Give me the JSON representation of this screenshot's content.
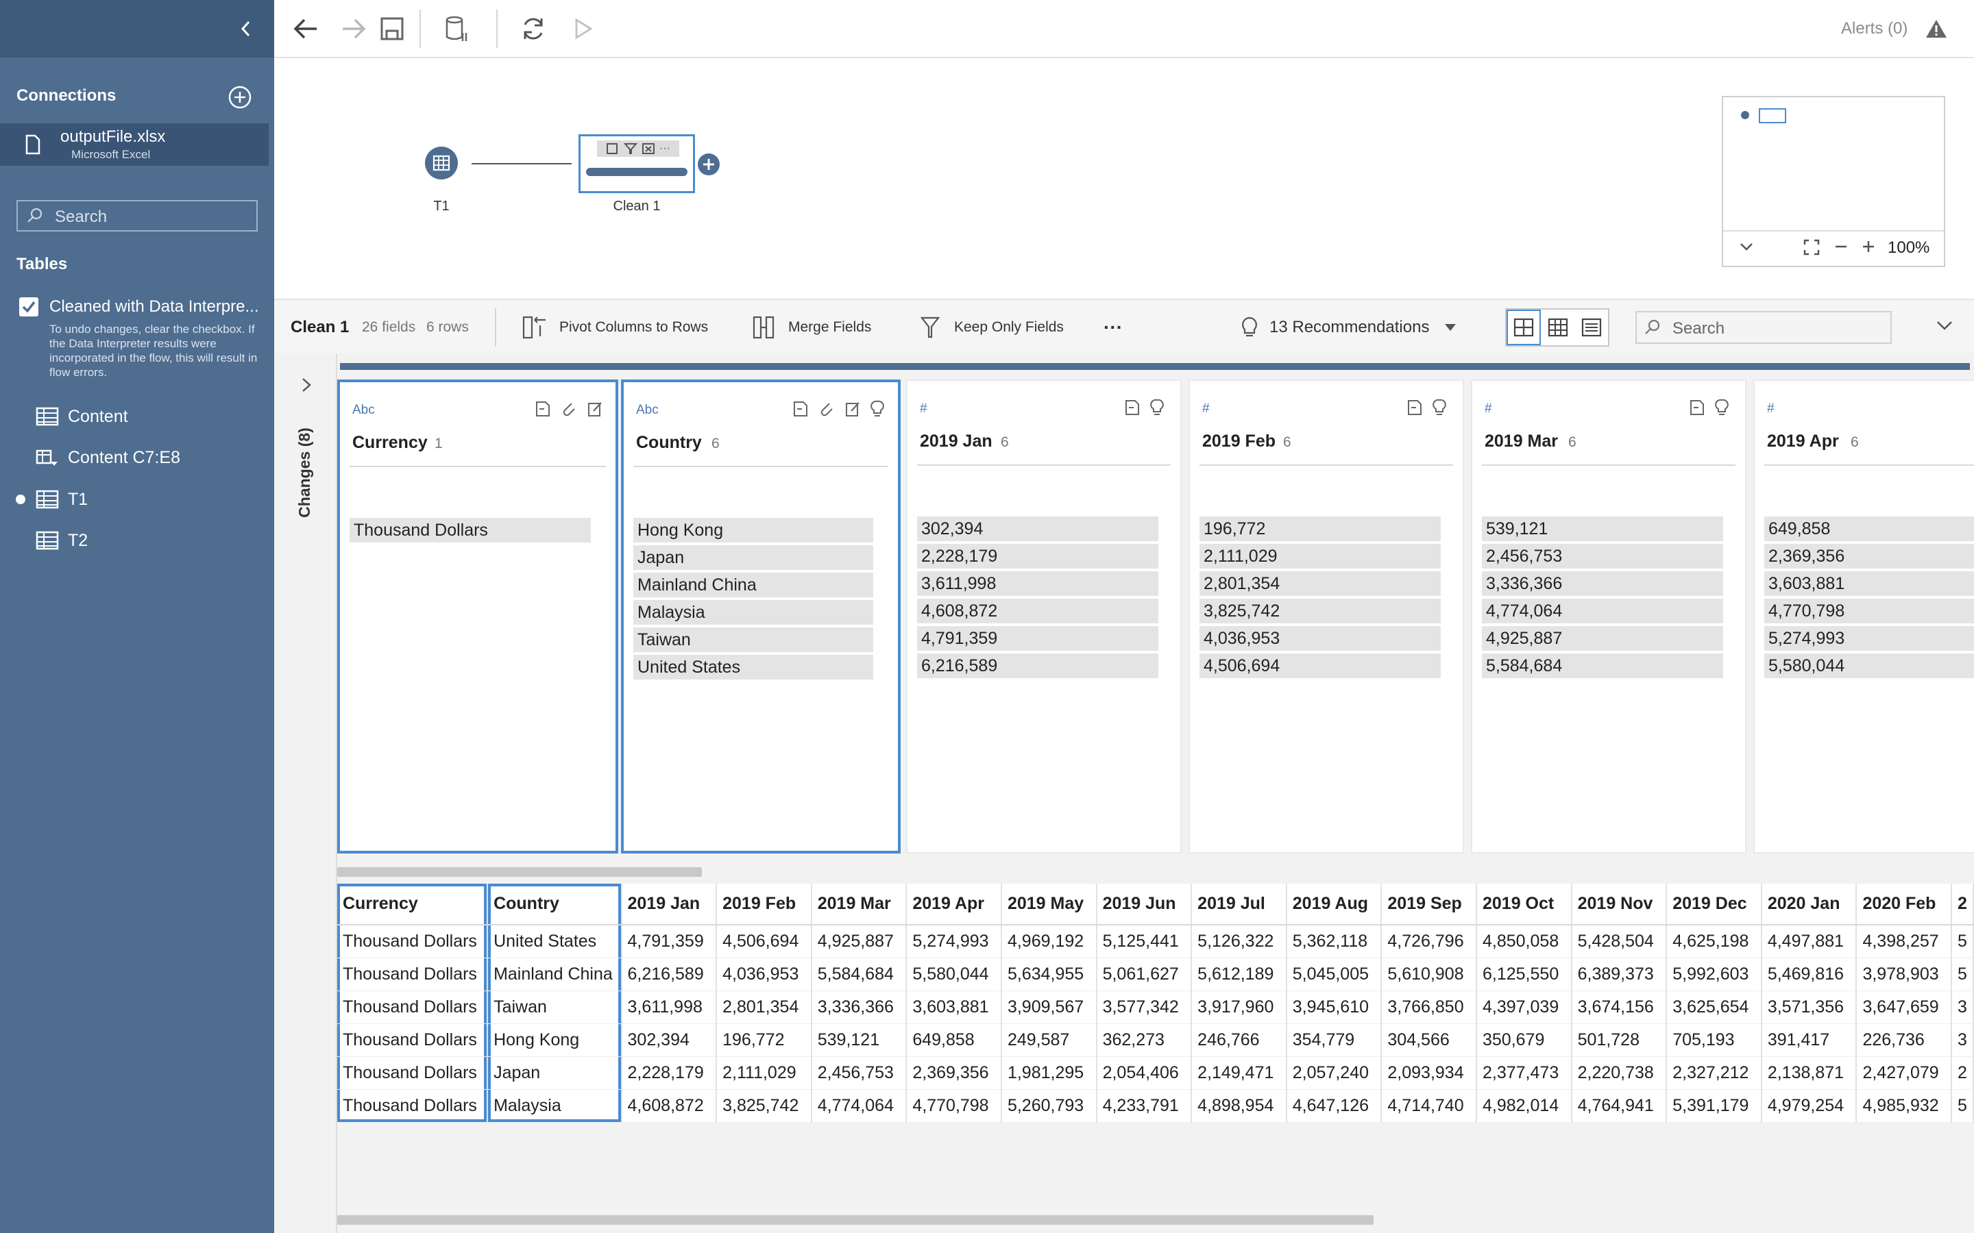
{
  "sidebar": {
    "connections_label": "Connections",
    "connection": {
      "name": "outputFile.xlsx",
      "type": "Microsoft Excel"
    },
    "search_placeholder": "Search",
    "tables_label": "Tables",
    "data_interpreter": {
      "label": "Cleaned with Data Interpre...",
      "note": "To undo changes, clear the checkbox. If the Data Interpreter results were incorporated in the flow, this will result in flow errors.",
      "checked": true
    },
    "tables": [
      {
        "label": "Content",
        "icon": "table-icon"
      },
      {
        "label": "Content C7:E8",
        "icon": "named-range-icon"
      },
      {
        "label": "T1",
        "icon": "table-icon",
        "in_flow": true
      },
      {
        "label": "T2",
        "icon": "table-icon"
      }
    ]
  },
  "toolbar": {
    "alerts_label": "Alerts (0)"
  },
  "flow": {
    "input_node_label": "T1",
    "clean_node_label": "Clean 1",
    "zoom_label": "100%"
  },
  "clean_bar": {
    "step_name": "Clean 1",
    "fields_label": "26 fields",
    "rows_label": "6 rows",
    "pivot_label": "Pivot Columns to Rows",
    "merge_label": "Merge Fields",
    "keep_label": "Keep Only Fields",
    "more_label": "···",
    "recommendations_label": "13 Recommendations",
    "search_placeholder": "Search"
  },
  "changes_label": "Changes (8)",
  "profile_cards": [
    {
      "type": "Abc",
      "name": "Currency",
      "count": "1",
      "values": [
        "Thousand Dollars"
      ]
    },
    {
      "type": "Abc",
      "name": "Country",
      "count": "6",
      "values": [
        "Hong Kong",
        "Japan",
        "Mainland China",
        "Malaysia",
        "Taiwan",
        "United States"
      ]
    },
    {
      "type": "#",
      "name": "2019 Jan",
      "count": "6",
      "values": [
        "302,394",
        "2,228,179",
        "3,611,998",
        "4,608,872",
        "4,791,359",
        "6,216,589"
      ]
    },
    {
      "type": "#",
      "name": "2019 Feb",
      "count": "6",
      "values": [
        "196,772",
        "2,111,029",
        "2,801,354",
        "3,825,742",
        "4,036,953",
        "4,506,694"
      ]
    },
    {
      "type": "#",
      "name": "2019 Mar",
      "count": "6",
      "values": [
        "539,121",
        "2,456,753",
        "3,336,366",
        "4,774,064",
        "4,925,887",
        "5,584,684"
      ]
    },
    {
      "type": "#",
      "name": "2019 Apr",
      "count": "6",
      "values": [
        "649,858",
        "2,369,356",
        "3,603,881",
        "4,770,798",
        "5,274,993",
        "5,580,044"
      ]
    }
  ],
  "grid": {
    "columns": [
      "Currency",
      "Country",
      "2019 Jan",
      "2019 Feb",
      "2019 Mar",
      "2019 Apr",
      "2019 May",
      "2019 Jun",
      "2019 Jul",
      "2019 Aug",
      "2019 Sep",
      "2019 Oct",
      "2019 Nov",
      "2019 Dec",
      "2020 Jan",
      "2020 Feb",
      "2"
    ],
    "rows": [
      [
        "Thousand Dollars",
        "United States",
        "4,791,359",
        "4,506,694",
        "4,925,887",
        "5,274,993",
        "4,969,192",
        "5,125,441",
        "5,126,322",
        "5,362,118",
        "4,726,796",
        "4,850,058",
        "5,428,504",
        "4,625,198",
        "4,497,881",
        "4,398,257",
        "5"
      ],
      [
        "Thousand Dollars",
        "Mainland China",
        "6,216,589",
        "4,036,953",
        "5,584,684",
        "5,580,044",
        "5,634,955",
        "5,061,627",
        "5,612,189",
        "5,045,005",
        "5,610,908",
        "6,125,550",
        "6,389,373",
        "5,992,603",
        "5,469,816",
        "3,978,903",
        "5"
      ],
      [
        "Thousand Dollars",
        "Taiwan",
        "3,611,998",
        "2,801,354",
        "3,336,366",
        "3,603,881",
        "3,909,567",
        "3,577,342",
        "3,917,960",
        "3,945,610",
        "3,766,850",
        "4,397,039",
        "3,674,156",
        "3,625,654",
        "3,571,356",
        "3,647,659",
        "3"
      ],
      [
        "Thousand Dollars",
        "Hong Kong",
        "302,394",
        "196,772",
        "539,121",
        "649,858",
        "249,587",
        "362,273",
        "246,766",
        "354,779",
        "304,566",
        "350,679",
        "501,728",
        "705,193",
        "391,417",
        "226,736",
        "3"
      ],
      [
        "Thousand Dollars",
        "Japan",
        "2,228,179",
        "2,111,029",
        "2,456,753",
        "2,369,356",
        "1,981,295",
        "2,054,406",
        "2,149,471",
        "2,057,240",
        "2,093,934",
        "2,377,473",
        "2,220,738",
        "2,327,212",
        "2,138,871",
        "2,427,079",
        "2"
      ],
      [
        "Thousand Dollars",
        "Malaysia",
        "4,608,872",
        "3,825,742",
        "4,774,064",
        "4,770,798",
        "5,260,793",
        "4,233,791",
        "4,898,954",
        "4,647,126",
        "4,714,740",
        "4,982,014",
        "4,764,941",
        "5,391,179",
        "4,979,254",
        "4,985,932",
        "5"
      ]
    ]
  },
  "colors": {
    "sidebar": "#4e6d8f",
    "accent": "#4a8bd0",
    "node": "#4e6d8f"
  }
}
